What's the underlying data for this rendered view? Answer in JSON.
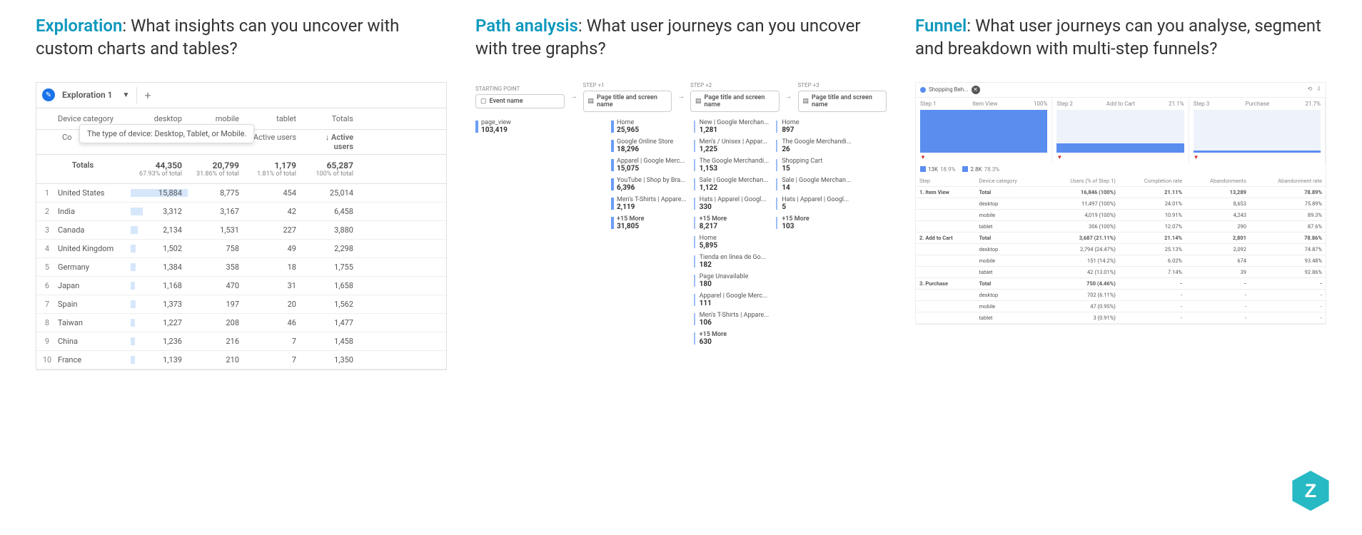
{
  "headlines": {
    "exploration_kw": "Exploration",
    "exploration_rest": ": What insights can you uncover with custom charts and tables?",
    "path_kw": "Path analysis",
    "path_rest": ": What user journeys can you uncover with tree graphs?",
    "funnel_kw": "Funnel",
    "funnel_rest": ": What user journeys can you analyse, segment and breakdown with multi-step funnels?"
  },
  "exploration": {
    "tab_title": "Exploration 1",
    "tooltip": "The type of device: Desktop, Tablet, or Mobile.",
    "dim_label": "Device category",
    "country_col_short": "Co",
    "columns": [
      "desktop",
      "mobile",
      "tablet",
      "Totals"
    ],
    "sub_header": "Active users",
    "sub_header_sort": "↓ Active users",
    "totals_label": "Totals",
    "totals": {
      "desktop": {
        "v": "44,350",
        "pct": "67.93% of total"
      },
      "mobile": {
        "v": "20,799",
        "pct": "31.86% of total"
      },
      "tablet": {
        "v": "1,179",
        "pct": "1.81% of total"
      },
      "all": {
        "v": "65,287",
        "pct": "100% of total"
      }
    },
    "rows": [
      {
        "i": "1",
        "country": "United States",
        "desktop": "15,884",
        "d_bar": 100,
        "mobile": "8,775",
        "tablet": "454",
        "total": "25,014"
      },
      {
        "i": "2",
        "country": "India",
        "desktop": "3,312",
        "d_bar": 21,
        "mobile": "3,167",
        "tablet": "42",
        "total": "6,458"
      },
      {
        "i": "3",
        "country": "Canada",
        "desktop": "2,134",
        "d_bar": 13,
        "mobile": "1,531",
        "tablet": "227",
        "total": "3,880"
      },
      {
        "i": "4",
        "country": "United Kingdom",
        "desktop": "1,502",
        "d_bar": 9,
        "mobile": "758",
        "tablet": "49",
        "total": "2,298"
      },
      {
        "i": "5",
        "country": "Germany",
        "desktop": "1,384",
        "d_bar": 9,
        "mobile": "358",
        "tablet": "18",
        "total": "1,755"
      },
      {
        "i": "6",
        "country": "Japan",
        "desktop": "1,168",
        "d_bar": 7,
        "mobile": "470",
        "tablet": "31",
        "total": "1,658"
      },
      {
        "i": "7",
        "country": "Spain",
        "desktop": "1,373",
        "d_bar": 9,
        "mobile": "197",
        "tablet": "20",
        "total": "1,562"
      },
      {
        "i": "8",
        "country": "Taiwan",
        "desktop": "1,227",
        "d_bar": 8,
        "mobile": "208",
        "tablet": "46",
        "total": "1,477"
      },
      {
        "i": "9",
        "country": "China",
        "desktop": "1,236",
        "d_bar": 8,
        "mobile": "216",
        "tablet": "7",
        "total": "1,458"
      },
      {
        "i": "10",
        "country": "France",
        "desktop": "1,139",
        "d_bar": 7,
        "mobile": "210",
        "tablet": "7",
        "total": "1,350"
      }
    ]
  },
  "path": {
    "steps": [
      {
        "top": "STARTING POINT",
        "icon": "tag",
        "label": "Event name"
      },
      {
        "top": "STEP +1",
        "icon": "page",
        "label": "Page title and screen name"
      },
      {
        "top": "STEP +2",
        "icon": "page",
        "label": "Page title and screen name"
      },
      {
        "top": "STEP +3",
        "icon": "page",
        "label": "Page title and screen name"
      }
    ],
    "col0": [
      {
        "nm": "page_view",
        "ct": "103,419"
      }
    ],
    "col1": [
      {
        "nm": "Home",
        "ct": "25,965"
      },
      {
        "nm": "Google Online Store",
        "ct": "18,296"
      },
      {
        "nm": "Apparel | Google Merc...",
        "ct": "15,075"
      },
      {
        "nm": "YouTube | Shop by Bra...",
        "ct": "6,396"
      },
      {
        "nm": "Men's T-Shirts | Appare...",
        "ct": "2,119"
      },
      {
        "nm": "+15 More",
        "ct": "31,805",
        "more": true
      }
    ],
    "col2": [
      {
        "nm": "New | Google Merchan...",
        "ct": "1,281"
      },
      {
        "nm": "Men's / Unisex | Appar...",
        "ct": "1,225"
      },
      {
        "nm": "The Google Merchandi...",
        "ct": "1,153"
      },
      {
        "nm": "Sale | Google Merchan...",
        "ct": "1,122"
      },
      {
        "nm": "Hats | Apparel | Googl...",
        "ct": "330"
      },
      {
        "nm": "+15 More",
        "ct": "8,217",
        "more": true
      },
      {
        "nm": "Home",
        "ct": "5,895"
      },
      {
        "nm": "Tienda en línea de Go...",
        "ct": "182"
      },
      {
        "nm": "Page Unavailable",
        "ct": "180"
      },
      {
        "nm": "Apparel | Google Merc...",
        "ct": "111"
      },
      {
        "nm": "Men's T-Shirts | Appare...",
        "ct": "106"
      },
      {
        "nm": "+15 More",
        "ct": "630",
        "more": true
      }
    ],
    "col3": [
      {
        "nm": "Home",
        "ct": "897"
      },
      {
        "nm": "The Google Merchandi...",
        "ct": "26"
      },
      {
        "nm": "Shopping Cart",
        "ct": "15"
      },
      {
        "nm": "Sale | Google Merchan...",
        "ct": "14"
      },
      {
        "nm": "Hats | Apparel | Googl...",
        "ct": "5"
      },
      {
        "nm": "+15 More",
        "ct": "103",
        "more": true
      }
    ]
  },
  "funnel": {
    "title": "Shopping Beh...",
    "steps": [
      {
        "n": "Step 1",
        "label": "Item View",
        "pct": "100%",
        "fill": 100
      },
      {
        "n": "Step 2",
        "label": "Add to Cart",
        "pct": "21.1%",
        "fill": 21
      },
      {
        "n": "Step 3",
        "label": "Purchase",
        "pct": "21.7%",
        "fill": 5
      }
    ],
    "legend": [
      {
        "v": "13K",
        "sub": "18.9%"
      },
      {
        "v": "2.8K",
        "sub": "78.3%"
      }
    ],
    "table_headers": [
      "Step",
      "Device category",
      "Users (% of Step 1)",
      "Completion rate",
      "Abandonments",
      "Abandonment rate"
    ],
    "table": [
      {
        "step": "1. Item View",
        "dev": "Total",
        "users": "16,846 (100%)",
        "cr": "21.11%",
        "ab": "13,289",
        "ar": "78.89%",
        "bold": true
      },
      {
        "step": "",
        "dev": "desktop",
        "users": "11,497 (100%)",
        "cr": "24.01%",
        "ab": "8,653",
        "ar": "75.89%"
      },
      {
        "step": "",
        "dev": "mobile",
        "users": "4,019 (100%)",
        "cr": "10.91%",
        "ab": "4,243",
        "ar": "89.3%"
      },
      {
        "step": "",
        "dev": "tablet",
        "users": "306 (100%)",
        "cr": "12.07%",
        "ab": "290",
        "ar": "87.6%"
      },
      {
        "step": "2. Add to Cart",
        "dev": "Total",
        "users": "3,687 (21.11%)",
        "cr": "21.14%",
        "ab": "2,801",
        "ar": "78.86%",
        "bold": true
      },
      {
        "step": "",
        "dev": "desktop",
        "users": "2,794 (24.47%)",
        "cr": "25.13%",
        "ab": "2,092",
        "ar": "74.87%"
      },
      {
        "step": "",
        "dev": "mobile",
        "users": "151 (14.2%)",
        "cr": "6.02%",
        "ab": "674",
        "ar": "93.48%"
      },
      {
        "step": "",
        "dev": "tablet",
        "users": "42 (13.01%)",
        "cr": "7.14%",
        "ab": "39",
        "ar": "92.86%"
      },
      {
        "step": "3. Purchase",
        "dev": "Total",
        "users": "750 (4.46%)",
        "cr": "-",
        "ab": "-",
        "ar": "-",
        "bold": true
      },
      {
        "step": "",
        "dev": "desktop",
        "users": "702 (6.11%)",
        "cr": "-",
        "ab": "-",
        "ar": "-"
      },
      {
        "step": "",
        "dev": "mobile",
        "users": "47 (0.95%)",
        "cr": "-",
        "ab": "-",
        "ar": "-"
      },
      {
        "step": "",
        "dev": "tablet",
        "users": "3 (0.91%)",
        "cr": "-",
        "ab": "-",
        "ar": "-"
      }
    ]
  }
}
